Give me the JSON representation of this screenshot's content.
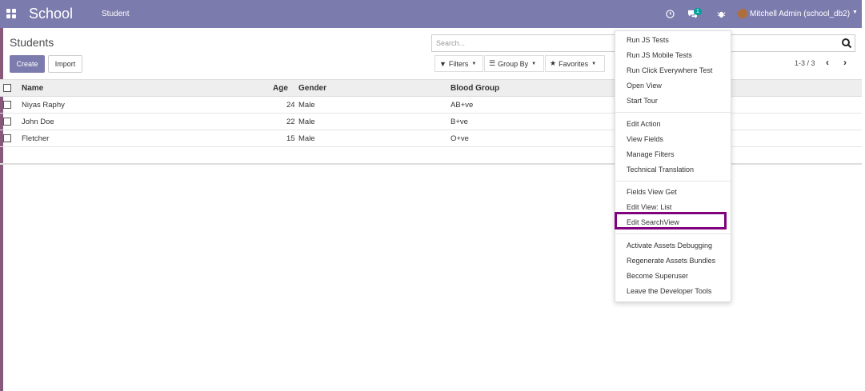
{
  "navbar": {
    "app_name": "School",
    "menu_student": "Student",
    "chat_badge": "1",
    "user": "Mitchell Admin (school_db2)",
    "color": "#7c7bad"
  },
  "control_panel": {
    "title": "Students",
    "create_label": "Create",
    "import_label": "Import",
    "search_placeholder": "Search...",
    "filters_label": "Filters",
    "group_by_label": "Group By",
    "favorites_label": "Favorites",
    "pager": "1-3 / 3"
  },
  "table": {
    "columns": [
      "Name",
      "Age",
      "Gender",
      "Blood Group"
    ],
    "rows": [
      {
        "name": "Niyas Raphy",
        "age": "24",
        "gender": "Male",
        "blood_group": "AB+ve"
      },
      {
        "name": "John Doe",
        "age": "22",
        "gender": "Male",
        "blood_group": "B+ve"
      },
      {
        "name": "Fletcher",
        "age": "15",
        "gender": "Male",
        "blood_group": "O+ve"
      }
    ]
  },
  "dev_menu": {
    "group1": [
      "Run JS Tests",
      "Run JS Mobile Tests",
      "Run Click Everywhere Test",
      "Open View",
      "Start Tour"
    ],
    "group2": [
      "Edit Action",
      "View Fields",
      "Manage Filters",
      "Technical Translation"
    ],
    "group3": [
      "Fields View Get",
      "Edit View: List",
      "Edit SearchView"
    ],
    "group4": [
      "Activate Assets Debugging",
      "Regenerate Assets Bundles",
      "Become Superuser",
      "Leave the Developer Tools"
    ],
    "highlight_color": "#800080"
  }
}
